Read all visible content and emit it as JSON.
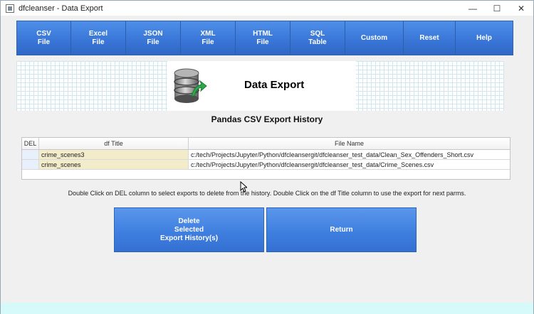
{
  "window": {
    "title": "dfcleanser - Data Export",
    "controls": {
      "minimize": "—",
      "maximize": "☐",
      "close": "✕"
    }
  },
  "toolbar": {
    "buttons": [
      {
        "label": "CSV\nFile"
      },
      {
        "label": "Excel\nFile"
      },
      {
        "label": "JSON\nFile"
      },
      {
        "label": "XML\nFile"
      },
      {
        "label": "HTML\nFile"
      },
      {
        "label": "SQL\nTable"
      },
      {
        "label": "Custom"
      },
      {
        "label": "Reset"
      },
      {
        "label": "Help"
      }
    ]
  },
  "banner": {
    "title": "Data Export",
    "icon": "database-export-icon"
  },
  "history": {
    "title": "Pandas CSV Export History",
    "columns": {
      "del": "DEL",
      "df_title": "df Title",
      "file_name": "File Name"
    },
    "rows": [
      {
        "del": "",
        "df_title": "crime_scenes3",
        "file_name": "c:/tech/Projects/Jupyter/Python/dfcleansergit/dfcleanser_test_data/Clean_Sex_Offenders_Short.csv"
      },
      {
        "del": "",
        "df_title": "crime_scenes",
        "file_name": "c:/tech/Projects/Jupyter/Python/dfcleansergit/dfcleanser_test_data/Crime_Scenes.csv"
      }
    ]
  },
  "instructions": "Double Click on DEL column to select exports to delete from the history. Double Click on the df Title column to use the export for next parms.",
  "actions": {
    "delete_label": "Delete\nSelected\nExport History(s)",
    "return_label": "Return"
  },
  "colors": {
    "button_blue": "#3a77d8",
    "title_cell": "#f2ecca",
    "bottom_strip": "#d6fafa"
  }
}
